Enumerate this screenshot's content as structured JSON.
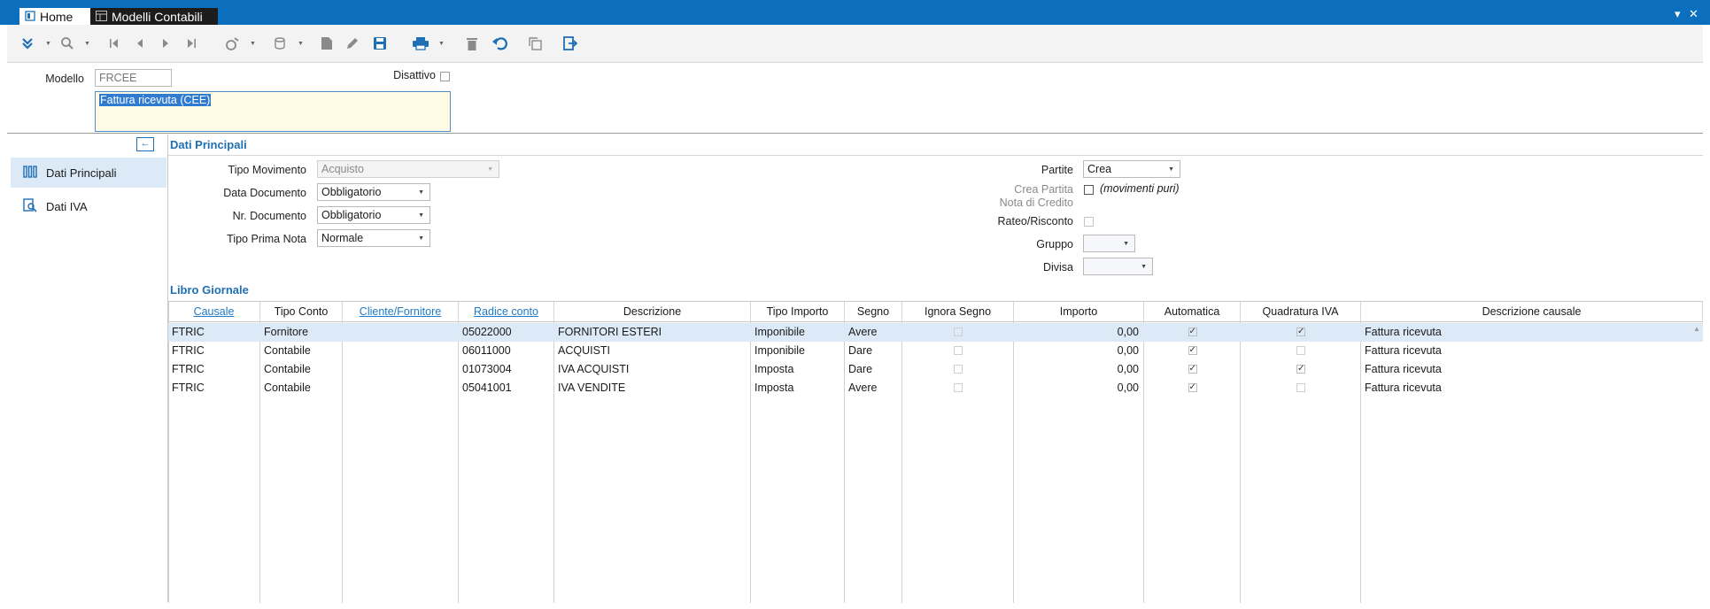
{
  "window": {
    "tabs": [
      {
        "label": "Home"
      },
      {
        "label": "Modelli Contabili"
      }
    ],
    "controls": {
      "menu": "▾",
      "close": "✕"
    }
  },
  "header": {
    "modello_label": "Modello",
    "modello_value": "FRCEE",
    "disattivo_label": "Disattivo",
    "disattivo_checked": false,
    "descrizione_value": "Fattura ricevuta (CEE)"
  },
  "side": {
    "collapse_glyph": "←",
    "items": [
      {
        "label": "Dati Principali",
        "icon": "columns-icon",
        "selected": true
      },
      {
        "label": "Dati IVA",
        "icon": "document-search-icon",
        "selected": false
      }
    ]
  },
  "dati_principali": {
    "title": "Dati Principali",
    "tipo_movimento": {
      "label": "Tipo Movimento",
      "value": "Acquisto"
    },
    "data_documento": {
      "label": "Data Documento",
      "value": "Obbligatorio"
    },
    "nr_documento": {
      "label": "Nr. Documento",
      "value": "Obbligatorio"
    },
    "tipo_prima_nota": {
      "label": "Tipo Prima Nota",
      "value": "Normale"
    },
    "partite": {
      "label": "Partite",
      "value": "Crea"
    },
    "crea_partita": {
      "label_line1": "Crea Partita",
      "label_line2": "Nota di Credito",
      "hint": "(movimenti puri)",
      "checked": false
    },
    "rateo": {
      "label": "Rateo/Risconto",
      "checked": false
    },
    "gruppo": {
      "label": "Gruppo",
      "value": ""
    },
    "divisa": {
      "label": "Divisa",
      "value": ""
    }
  },
  "libro_giornale": {
    "title": "Libro Giornale",
    "columns": [
      {
        "label": "Causale",
        "link": true
      },
      {
        "label": "Tipo Conto",
        "link": false
      },
      {
        "label": "Cliente/Fornitore",
        "link": true
      },
      {
        "label": "Radice conto",
        "link": true
      },
      {
        "label": "Descrizione",
        "link": false
      },
      {
        "label": "Tipo Importo",
        "link": false
      },
      {
        "label": "Segno",
        "link": false
      },
      {
        "label": "Ignora Segno",
        "link": false
      },
      {
        "label": "Importo",
        "link": false
      },
      {
        "label": "Automatica",
        "link": false
      },
      {
        "label": "Quadratura IVA",
        "link": false
      },
      {
        "label": "Descrizione causale",
        "link": false
      }
    ],
    "rows": [
      {
        "causale": "FTRIC",
        "tipo_conto": "Fornitore",
        "cliente_fornitore": "",
        "radice": "05022000",
        "descrizione": "FORNITORI ESTERI",
        "tipo_importo": "Imponibile",
        "segno": "Avere",
        "ignora_segno": false,
        "importo": "0,00",
        "automatica": true,
        "quadratura_iva": true,
        "descrizione_causale": "Fattura ricevuta"
      },
      {
        "causale": "FTRIC",
        "tipo_conto": "Contabile",
        "cliente_fornitore": "",
        "radice": "06011000",
        "descrizione": "ACQUISTI",
        "tipo_importo": "Imponibile",
        "segno": "Dare",
        "ignora_segno": false,
        "importo": "0,00",
        "automatica": true,
        "quadratura_iva": false,
        "descrizione_causale": "Fattura ricevuta"
      },
      {
        "causale": "FTRIC",
        "tipo_conto": "Contabile",
        "cliente_fornitore": "",
        "radice": "01073004",
        "descrizione": "IVA ACQUISTI",
        "tipo_importo": "Imposta",
        "segno": "Dare",
        "ignora_segno": false,
        "importo": "0,00",
        "automatica": true,
        "quadratura_iva": true,
        "descrizione_causale": "Fattura ricevuta"
      },
      {
        "causale": "FTRIC",
        "tipo_conto": "Contabile",
        "cliente_fornitore": "",
        "radice": "05041001",
        "descrizione": "IVA VENDITE",
        "tipo_importo": "Imposta",
        "segno": "Avere",
        "ignora_segno": false,
        "importo": "0,00",
        "automatica": true,
        "quadratura_iva": false,
        "descrizione_causale": "Fattura ricevuta"
      }
    ]
  },
  "colors": {
    "titlebar": "#0b6fbd",
    "accent": "#1f6fb5",
    "selected_row": "#dce9f7"
  }
}
